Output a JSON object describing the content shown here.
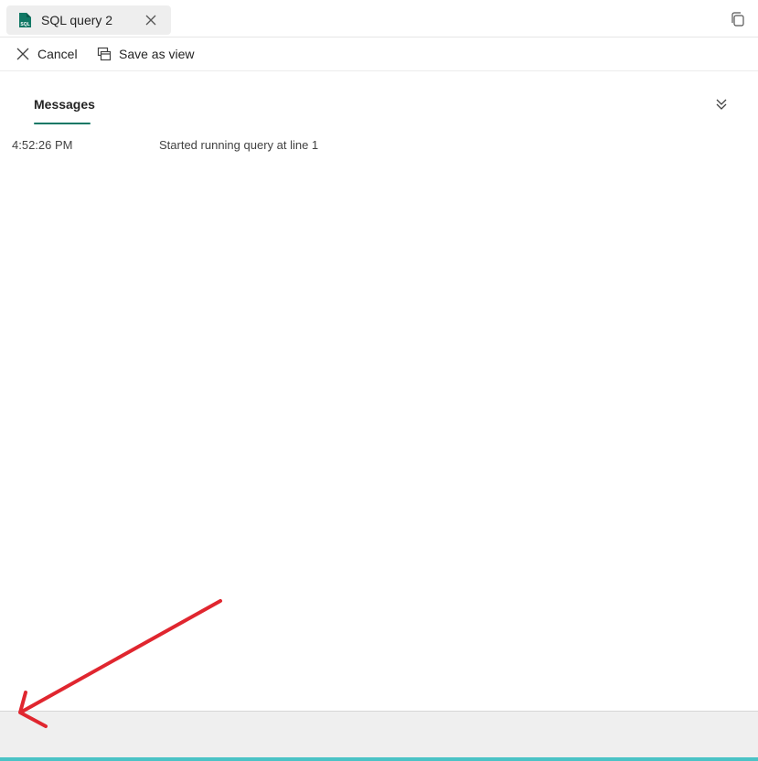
{
  "tab": {
    "title": "SQL query 2",
    "icon": "sql-file-icon",
    "close_icon": "close-icon"
  },
  "window": {
    "restore_icon": "restore-icon"
  },
  "toolbar": {
    "cancel_label": "Cancel",
    "cancel_icon": "close-icon",
    "save_view_label": "Save as view",
    "save_view_icon": "save-as-view-icon"
  },
  "results": {
    "tab_label": "Messages",
    "collapse_icon": "chevron-double-down-icon",
    "messages": [
      {
        "time": "4:52:26 PM",
        "text": "Started running query at line 1"
      }
    ]
  },
  "colors": {
    "accent": "#117865",
    "status_accent": "#4bc3c6",
    "annotation": "#e0262f"
  }
}
